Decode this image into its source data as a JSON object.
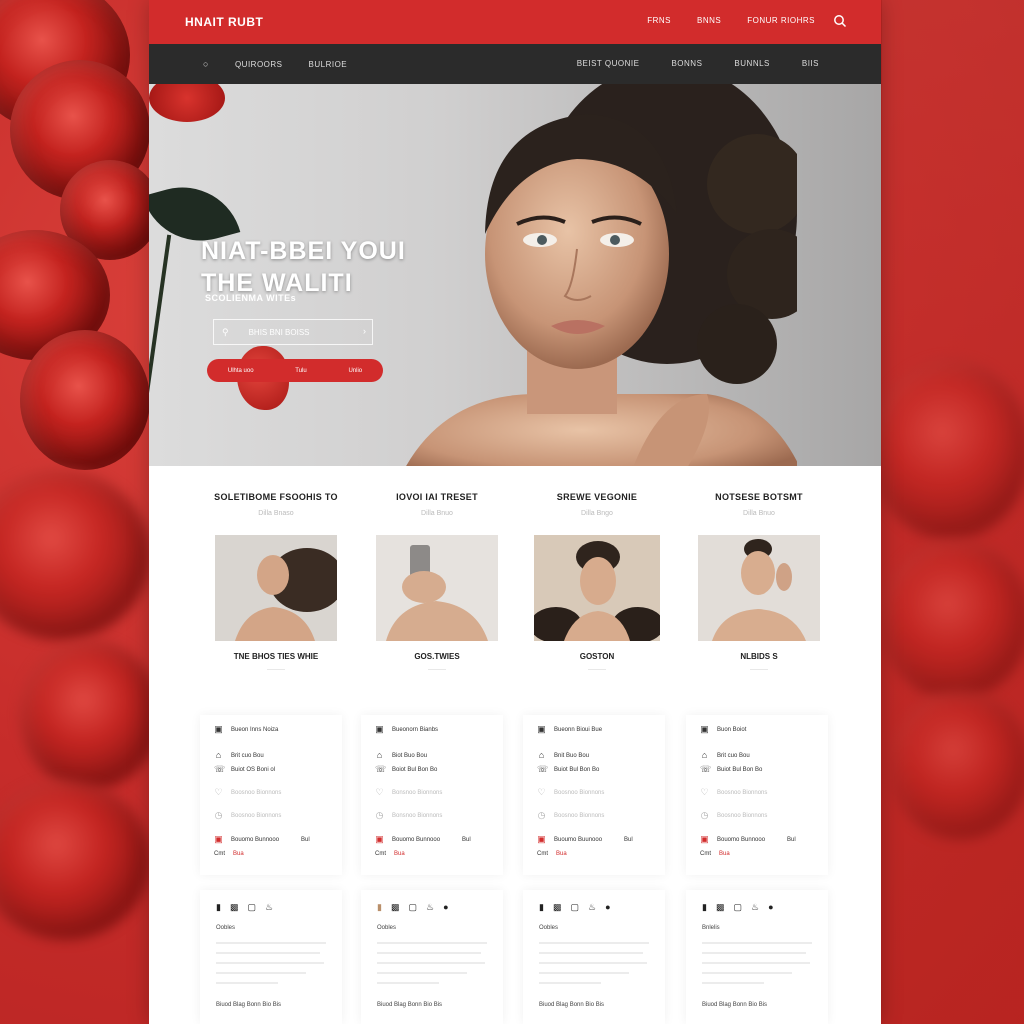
{
  "header": {
    "brand": "HNAIT RUBT",
    "links": [
      "FRNS",
      "BNNS",
      "FONUR RIOHRS"
    ]
  },
  "nav": {
    "left": [
      "QUIROORS",
      "BULRIOE"
    ],
    "right": [
      "BEIST QUONIE",
      "BONNS",
      "BUNNLS",
      "BIIS"
    ]
  },
  "hero": {
    "title_line1": "NIAT-BBEI YOUI",
    "title_line2": "THE WALITI",
    "subtitle": "SCOLIENMA WITEs",
    "search_placeholder": "BHIS BNI BOISS",
    "cta_items": [
      "Ulhta uoo",
      "Tulu",
      "Unlio"
    ]
  },
  "categories": [
    {
      "title": "SOLETIBOME FSOOHIS TO",
      "sub": "Dilla Bnaso",
      "caption": "TNE BHOS TIES  WHIE"
    },
    {
      "title": "IOVOI IAI TRESET",
      "sub": "Dilla Bnuo",
      "caption": "GOS.TWIES"
    },
    {
      "title": "SREWE VEGONIE",
      "sub": "Dilla Bngo",
      "caption": "GOSTON"
    },
    {
      "title": "NOTSESE BOTSMT",
      "sub": "Dilla Bnuo",
      "caption": "NLBIDS S"
    }
  ],
  "info_cards": [
    {
      "head": "Bueon Inns Noiza",
      "r1": "Brit cuo Bou",
      "r2": "Buiot OS Boni ol",
      "r3": "Boosnoo Bionnons",
      "r4": "Bouomo Bunnooo",
      "r4b": "Bul",
      "r5a": "Cmt",
      "r5b": "Bua"
    },
    {
      "head": "Bueonorn Bianbs",
      "r1": "Biot Buo Bou",
      "r2": "Boiot Bul Bon Bo",
      "r3": "Bonsnoo Bionnons",
      "r4": "Bouomo Bunnooo",
      "r4b": "Bul",
      "r5a": "Cmt",
      "r5b": "Bua"
    },
    {
      "head": "Bueonn Bioui Bue",
      "r1": "Bnit Buo Bou",
      "r2": "Buiot Bul Bon Bo",
      "r3": "Boosnoo Bionnons",
      "r4": "Buoumo Buunooo",
      "r4b": "Bul",
      "r5a": "Cmt",
      "r5b": "Bua"
    },
    {
      "head": "Buon Boiot",
      "r1": "Brit cuo Bou",
      "r2": "Buiot Bul Bon Bo",
      "r3": "Boosnoo Bionnons",
      "r4": "Bouomo Bunnooo",
      "r4b": "Bul",
      "r5a": "Cmt",
      "r5b": "Bua"
    }
  ],
  "text_cards": [
    {
      "label": "Oobles",
      "footer": "Biuod Blag Bonn Bio Bis"
    },
    {
      "label": "Oobles",
      "footer": "Biuod Blag Bonn Bio Bis"
    },
    {
      "label": "Oobles",
      "footer": "Biuod Blag Bonn Bio Bis"
    },
    {
      "label": "Bnlelis",
      "footer": "Biuod Blag Bonn Bio Bis"
    }
  ],
  "colors": {
    "brand_red": "#d22c2c",
    "nav_dark": "#2b2b2b"
  }
}
